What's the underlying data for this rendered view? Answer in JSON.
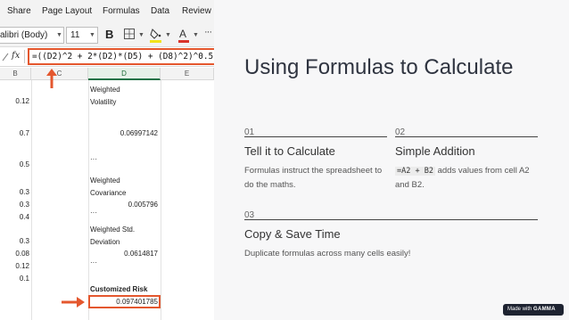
{
  "excel": {
    "menu": [
      "Share",
      "Page Layout",
      "Formulas",
      "Data",
      "Review"
    ],
    "font_name": "alibri (Body)",
    "font_size": "11",
    "bold": "B",
    "more": "···",
    "fx": "fx",
    "formula": "=((D2)^2 + 2*(D2)*(D5) + (D8)^2)^0.5",
    "columns": [
      "B",
      "C",
      "D",
      "E"
    ],
    "col_b_values": [
      "0.12",
      "0.7",
      "0.5",
      "0.3",
      "0.3",
      "0.4",
      "0.3",
      "0.08",
      "0.12",
      "0.1"
    ],
    "col_d": {
      "weighted_volatility_l1": "Weighted",
      "weighted_volatility_l2": "Volatility",
      "weighted_volatility_value": "0.06997142",
      "ellipsis1": "···",
      "weighted_covariance_l1": "Weighted",
      "weighted_covariance_l2": "Covariance",
      "weighted_covariance_value": "0.005796",
      "ellipsis2": "···",
      "weighted_std_l1": "Weighted Std.",
      "weighted_std_l2": "Deviation",
      "weighted_std_value": "0.0614817",
      "ellipsis3": "···",
      "customized_risk_label": "Customized Risk",
      "customized_risk_value": "0.097401785"
    },
    "colors": {
      "highlight": "#e4572e",
      "excel_green": "#217346"
    }
  },
  "slide": {
    "title": "Using Formulas to Calculate",
    "items": [
      {
        "number": "01",
        "heading": "Tell it to Calculate",
        "text": "Formulas instruct the spreadsheet to do the maths."
      },
      {
        "number": "02",
        "heading": "Simple Addition",
        "code": "=A2 + B2",
        "text": " adds values from cell A2 and B2."
      },
      {
        "number": "03",
        "heading": "Copy & Save Time",
        "text": "Duplicate formulas across many cells easily!"
      }
    ],
    "badge_prefix": "Made with",
    "badge_brand": "GAMMA"
  }
}
